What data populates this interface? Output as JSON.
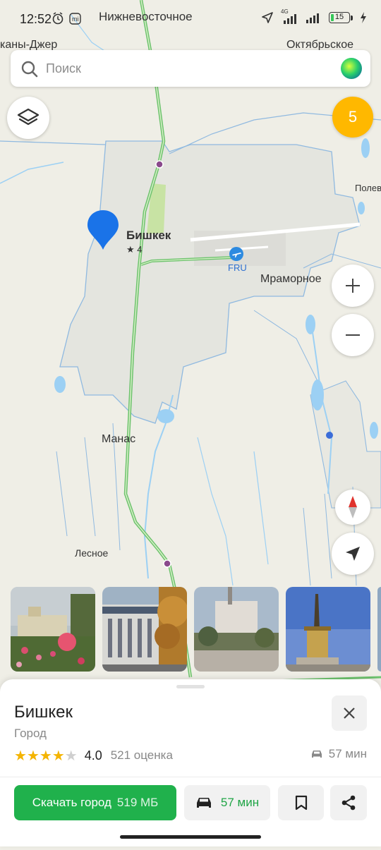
{
  "status_bar": {
    "time": "12:52",
    "network": "4G",
    "battery": "15"
  },
  "map": {
    "labels": {
      "top_center": "Нижневосточное",
      "top_left": "каны-Джер",
      "top_right": "Октябрьское",
      "right_edge": "Полев",
      "city": "Бишкек",
      "city_rating": "★ 4",
      "airport_code": "FRU",
      "village_marble": "Мраморное",
      "village_manas": "Манас",
      "village_lesnoe": "Лесное"
    },
    "colors": {
      "background": "#efeee6",
      "urban_area": "#e6e7e1",
      "boundary": "#8fb9e0",
      "water": "#9cd0f4",
      "highway": "#6ec36e",
      "pin": "#1a73e8"
    }
  },
  "search": {
    "placeholder": "Поиск",
    "icon": "search-icon",
    "assistant_icon": "alice-orb-icon"
  },
  "controls": {
    "layers_icon": "layers-icon",
    "notifications_count": "5",
    "zoom_in_icon": "plus-icon",
    "zoom_out_icon": "minus-icon",
    "compass_icon": "compass-icon",
    "locate_icon": "navigation-arrow-icon"
  },
  "photos": [
    {
      "description_name": "photo-station-garden"
    },
    {
      "description_name": "photo-university-building"
    },
    {
      "description_name": "photo-philharmonic"
    },
    {
      "description_name": "photo-monument-tower"
    }
  ],
  "place_card": {
    "title": "Бишкек",
    "subtitle": "Город",
    "rating": "4.0",
    "rating_value": 4.0,
    "rating_count": "521 оценка",
    "drive_time": "57 мин",
    "download_label": "Скачать город",
    "download_size": "519 МБ",
    "route_time": "57 мин",
    "accent_green": "#20b14c"
  }
}
